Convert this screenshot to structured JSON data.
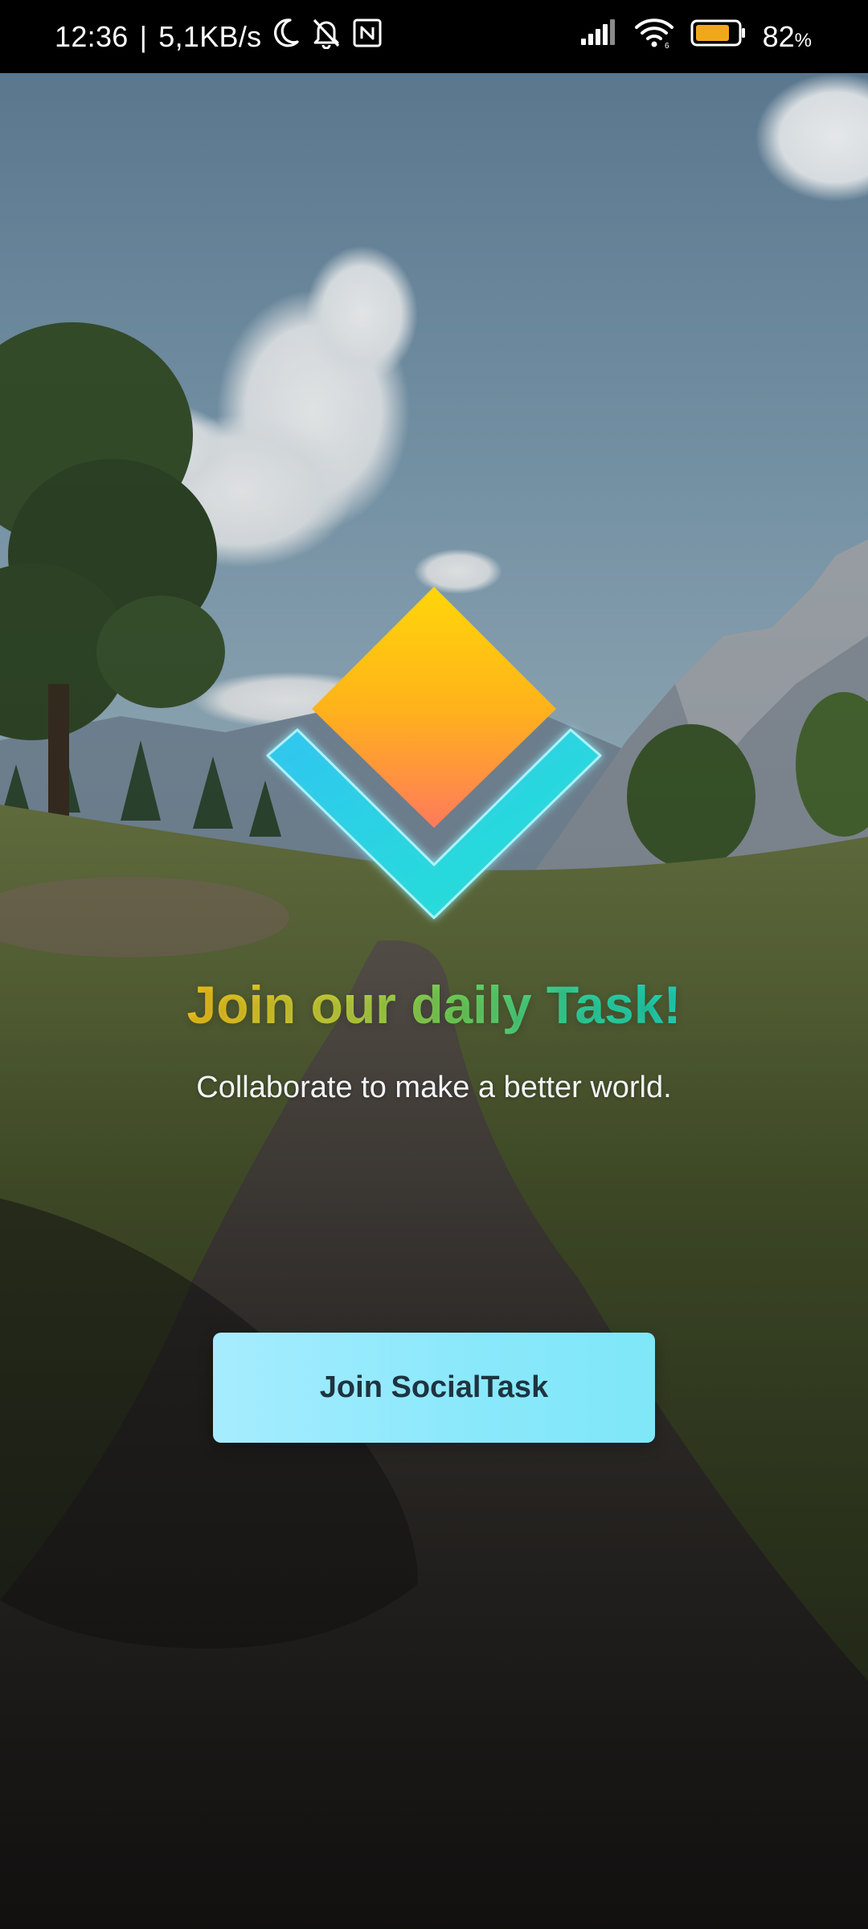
{
  "status_bar": {
    "time": "12:36",
    "separator": "|",
    "net_speed": "5,1KB/s",
    "battery_percent": "82",
    "battery_percent_sign": "%",
    "battery_level": 0.82,
    "icons": [
      "moon-icon",
      "bell-off-icon",
      "nfc-icon",
      "signal-icon",
      "wifi-icon",
      "battery-icon"
    ]
  },
  "onboarding": {
    "headline": "Join our daily Task!",
    "subheadline": "Collaborate to make a better world.",
    "join_button_label": "Join SocialTask"
  },
  "colors": {
    "headline_gradient_start": "#f5c518",
    "headline_gradient_end": "#1fd6b9",
    "button_bg": "#8ae8fb",
    "button_text": "#1d3440",
    "logo_diamond_top": "#ffd60a",
    "logo_diamond_bottom": "#ff7a5c",
    "logo_chevron": "#22e0e8"
  }
}
